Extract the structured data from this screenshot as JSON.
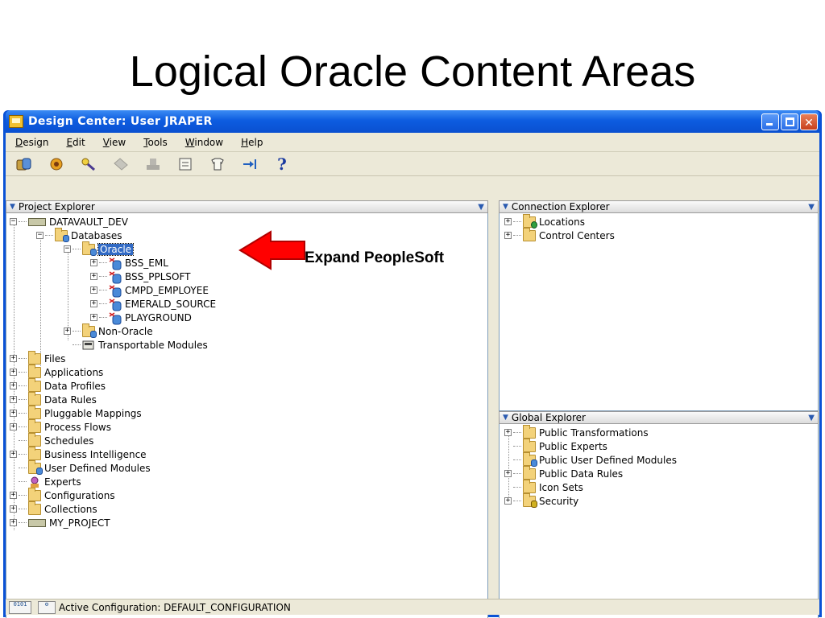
{
  "slide": {
    "title": "Logical Oracle Content Areas"
  },
  "window": {
    "title": "Design Center: User JRAPER"
  },
  "menu": [
    "Design",
    "Edit",
    "View",
    "Tools",
    "Window",
    "Help"
  ],
  "toolbar": {
    "icons": [
      "database-icon",
      "deploy-icon",
      "key-icon",
      "tag-icon",
      "stamp-icon",
      "sheet-icon",
      "shirt-icon",
      "arrow-icon",
      "help-icon"
    ],
    "help_label": "?"
  },
  "project_explorer": {
    "header": "Project Explorer",
    "nodes": {
      "root": "DATAVAULT_DEV",
      "databases": "Databases",
      "oracle": "Oracle",
      "bss_eml": "BSS_EML",
      "bss_pplsoft": "BSS_PPLSOFT",
      "cmpd": "CMPD_EMPLOYEE",
      "emerald": "EMERALD_SOURCE",
      "playground": "PLAYGROUND",
      "non_oracle": "Non-Oracle",
      "transportable": "Transportable Modules",
      "files": "Files",
      "applications": "Applications",
      "data_profiles": "Data Profiles",
      "data_rules": "Data Rules",
      "pluggable": "Pluggable Mappings",
      "process_flows": "Process Flows",
      "schedules": "Schedules",
      "bi": "Business Intelligence",
      "udm": "User Defined Modules",
      "experts": "Experts",
      "configurations": "Configurations",
      "collections": "Collections",
      "my_project": "MY_PROJECT"
    }
  },
  "connection_explorer": {
    "header": "Connection Explorer",
    "nodes": {
      "locations": "Locations",
      "control_centers": "Control Centers"
    }
  },
  "global_explorer": {
    "header": "Global Explorer",
    "nodes": {
      "public_transformations": "Public Transformations",
      "public_experts": "Public Experts",
      "public_udm": "Public User Defined Modules",
      "public_data_rules": "Public Data Rules",
      "icon_sets": "Icon Sets",
      "security": "Security"
    }
  },
  "status_bar": {
    "text": "Active Configuration: DEFAULT_CONFIGURATION"
  },
  "callout": {
    "text": "Expand PeopleSoft",
    "color": "#ff0000"
  },
  "colors": {
    "titlebar": "#0a52d6",
    "selection": "#316ac5"
  }
}
